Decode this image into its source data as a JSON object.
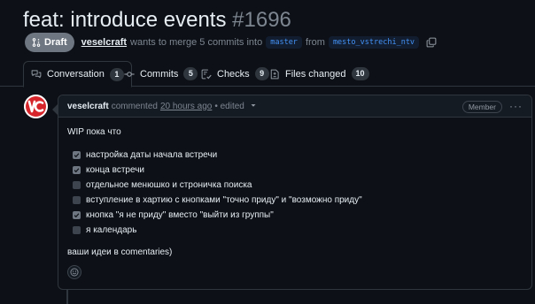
{
  "pr": {
    "title": "feat: introduce events",
    "number": "#1696",
    "status": "Draft",
    "author": "veselcraft",
    "meta_text": "wants to merge 5 commits into",
    "base_branch": "master",
    "from_text": "from",
    "head_branch": "mesto_vstrechi_ntv"
  },
  "tabs": [
    {
      "label": "Conversation",
      "count": "1",
      "icon": "comment-discussion-icon"
    },
    {
      "label": "Commits",
      "count": "5",
      "icon": "git-commit-icon"
    },
    {
      "label": "Checks",
      "count": "9",
      "icon": "checklist-icon"
    },
    {
      "label": "Files changed",
      "count": "10",
      "icon": "file-diff-icon"
    }
  ],
  "comment": {
    "author": "veselcraft",
    "action": "commented",
    "time": "20 hours ago",
    "edited": "• edited",
    "badge": "Member",
    "intro": "WIP пока что",
    "tasks": [
      {
        "label": "настройка даты начала встречи",
        "checked": true
      },
      {
        "label": "конца встречи",
        "checked": true
      },
      {
        "label": "отдельное менюшко и строничка поиска",
        "checked": false
      },
      {
        "label": "вступление в хартию с кнопками \"точно приду\" и \"возможно приду\"",
        "checked": false
      },
      {
        "label": "кнопка \"я не приду\" вместо \"выйти из группы\"",
        "checked": true
      },
      {
        "label": "я календарь",
        "checked": false
      }
    ],
    "outro": "ваши идеи в comentaries)"
  },
  "colors": {
    "background": "#0d1117",
    "border": "#30363d",
    "link": "#4493f8",
    "draft": "#6e7681",
    "avatar_brand": "#d7262b"
  }
}
